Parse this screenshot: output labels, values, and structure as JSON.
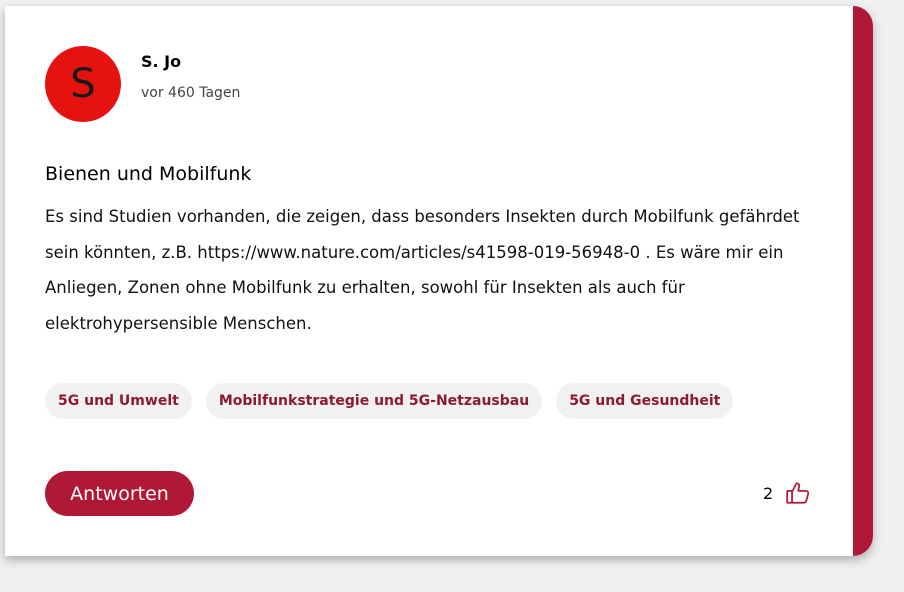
{
  "post": {
    "author": {
      "initial": "S",
      "name": "S. Jo",
      "avatar_color": "#e5120f"
    },
    "time": "vor 460 Tagen",
    "title": "Bienen und Mobilfunk",
    "body": "Es sind Studien vorhanden, die zeigen, dass besonders Insekten durch Mobilfunk gefährdet sein könnten, z.B. https://www.nature.com/articles/s41598-019-56948-0 . Es wäre mir ein Anliegen, Zonen ohne Mobilfunk zu erhalten, sowohl für Insekten als auch für elektrohypersensible Menschen.",
    "tags": [
      "5G und Umwelt",
      "Mobilfunkstrategie und 5G-Netzausbau",
      "5G und Gesundheit"
    ],
    "reply_label": "Antworten",
    "likes": "2",
    "like_icon": "thumbs-up-icon"
  },
  "colors": {
    "accent": "#b01935",
    "tag_text": "#8d1a2e",
    "tag_background": "#f1f1f1"
  }
}
